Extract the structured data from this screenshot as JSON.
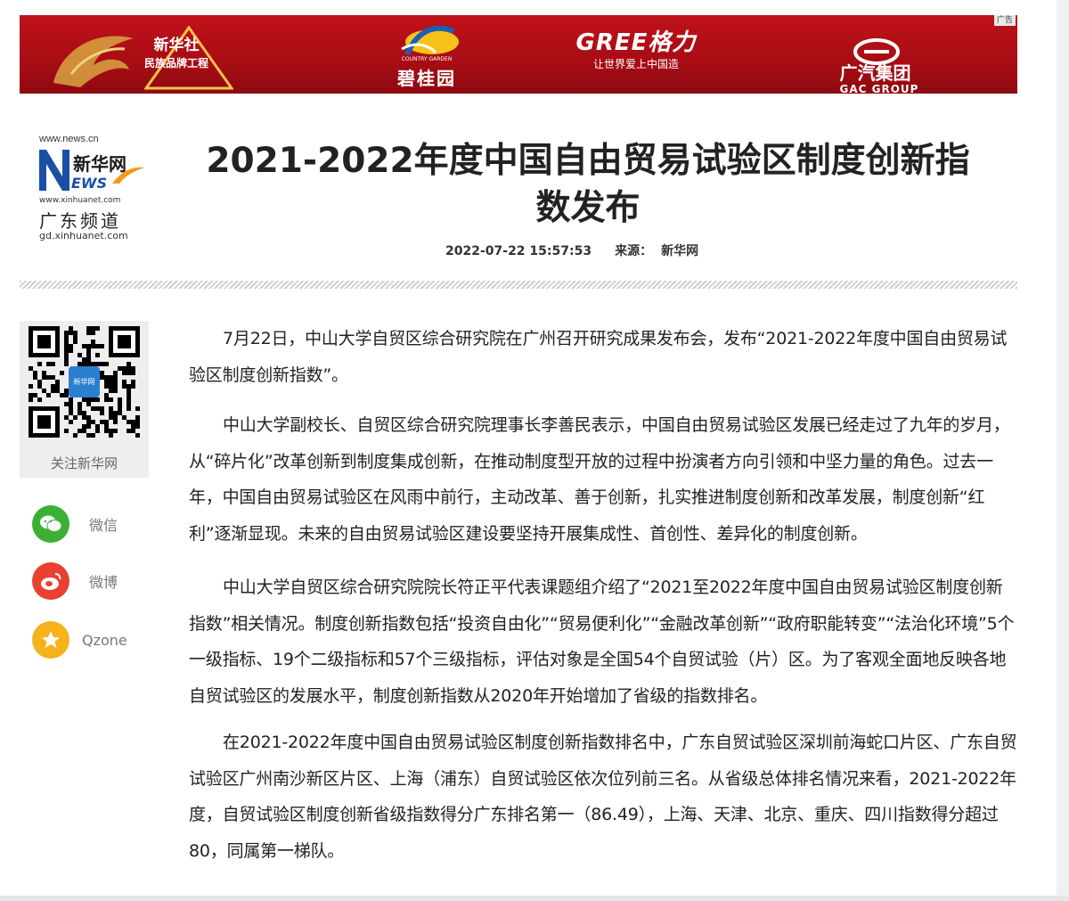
{
  "banner": {
    "ad_tag": "广告",
    "xinhua_brand": "新华社",
    "xinhua_project": "民族品牌工程",
    "country_garden_en": "COUNTRY GARDEN",
    "country_garden_name": "碧桂园",
    "gree_name": "GREE格力",
    "gree_slogan": "让世界爱上中国造",
    "gac_name": "广汽集团",
    "gac_en": "GAC GROUP",
    "colors": {
      "background": "#b3101a",
      "gree_blue": "#1b5fb3"
    }
  },
  "site_logo": {
    "url_top": "www.news.cn",
    "name": "新华网",
    "news_word": "EWS",
    "url_mid": "www.xinhuanet.com",
    "channel": "广东频道",
    "url_bottom": "gd.xinhuanet.com"
  },
  "article": {
    "title": "2021-2022年度中国自由贸易试验区制度创新指数发布",
    "datetime": "2022-07-22 15:57:53",
    "source_label": "来源：",
    "source": "新华网",
    "paragraphs": [
      "7月22日，中山大学自贸区综合研究院在广州召开研究成果发布会，发布“2021-2022年度中国自由贸易试验区制度创新指数”。",
      "中山大学副校长、自贸区综合研究院理事长李善民表示，中国自由贸易试验区发展已经走过了九年的岁月，从“碎片化”改革创新到制度集成创新，在推动制度型开放的过程中扮演者方向引领和中坚力量的角色。过去一年，中国自由贸易试验区在风雨中前行，主动改革、善于创新，扎实推进制度创新和改革发展，制度创新“红利”逐渐显现。未来的自由贸易试验区建设要坚持开展集成性、首创性、差异化的制度创新。",
      "中山大学自贸区综合研究院院长符正平代表课题组介绍了“2021至2022年度中国自由贸易试验区制度创新指数”相关情况。制度创新指数包括“投资自由化”“贸易便利化”“金融改革创新”“政府职能转变”“法治化环境”5个一级指标、19个二级指标和57个三级指标，评估对象是全国54个自贸试验（片）区。为了客观全面地反映各地自贸试验区的发展水平，制度创新指数从2020年开始增加了省级的指数排名。",
      "在2021-2022年度中国自由贸易试验区制度创新指数排名中，广东自贸试验区深圳前海蛇口片区、广东自贸试验区广州南沙新区片区、上海（浦东）自贸试验区依次位列前三名。从省级总体排名情况来看，2021-2022年度，自贸试验区制度创新省级指数得分广东排名第一（86.49），上海、天津、北京、重庆、四川指数得分超过80，同属第一梯队。"
    ]
  },
  "sidebar": {
    "qr_label": "关注新华网",
    "qr_center": "新华网",
    "share": [
      {
        "label": "微信",
        "icon": "wechat-icon",
        "color": "#3cb034"
      },
      {
        "label": "微博",
        "icon": "weibo-icon",
        "color": "#e8412f"
      },
      {
        "label": "Qzone",
        "icon": "qzone-icon",
        "color": "#f6b21a"
      }
    ]
  }
}
